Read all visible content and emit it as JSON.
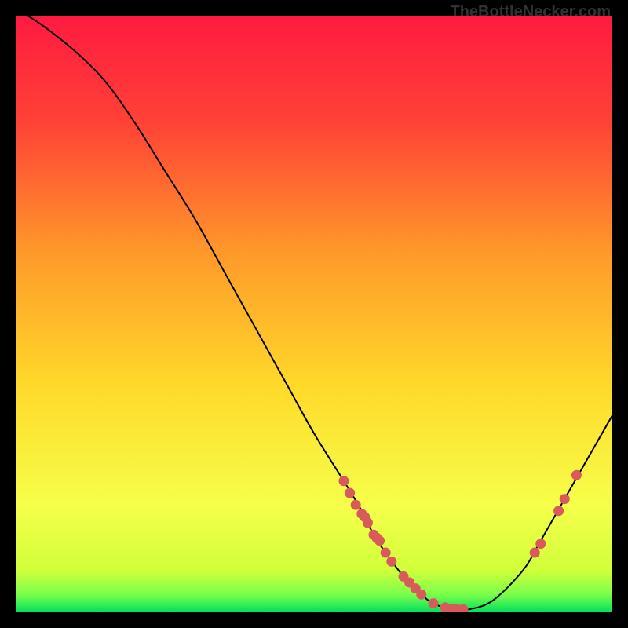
{
  "watermark": "TheBottleNecker.com",
  "chart_data": {
    "type": "line",
    "title": "",
    "xlabel": "",
    "ylabel": "",
    "xlim": [
      0,
      100
    ],
    "ylim": [
      0,
      100
    ],
    "background_gradient": {
      "top": "#ff1a40",
      "mid_upper": "#ff6a2a",
      "mid": "#ffd92a",
      "mid_lower": "#f6ff2a",
      "bottom": "#00e05c"
    },
    "series": [
      {
        "name": "bottleneck-curve",
        "type": "line",
        "color": "#000000",
        "x": [
          2,
          5,
          10,
          15,
          20,
          25,
          30,
          35,
          40,
          45,
          50,
          55,
          58,
          60,
          62,
          65,
          68,
          70,
          73,
          76,
          80,
          85,
          88,
          92,
          96,
          100
        ],
        "y": [
          100,
          98,
          94,
          89,
          82,
          74,
          66,
          57,
          48,
          39,
          30,
          22,
          17,
          13,
          10,
          6,
          3,
          1.5,
          0.5,
          0.5,
          2,
          7,
          12,
          19,
          26,
          33
        ]
      },
      {
        "name": "data-points",
        "type": "scatter",
        "color": "#d85a5a",
        "x": [
          55,
          56,
          57,
          58,
          58.5,
          59,
          60,
          60.5,
          61,
          62,
          63,
          65,
          66,
          67,
          68,
          70,
          72,
          73,
          74,
          75,
          87,
          88,
          91,
          92,
          94
        ],
        "y": [
          22,
          20,
          18,
          16.5,
          16,
          15,
          13,
          12.5,
          12,
          10,
          8.5,
          6,
          5,
          4,
          3,
          1.5,
          0.8,
          0.6,
          0.5,
          0.5,
          10,
          11.5,
          17,
          19,
          23
        ]
      }
    ]
  }
}
